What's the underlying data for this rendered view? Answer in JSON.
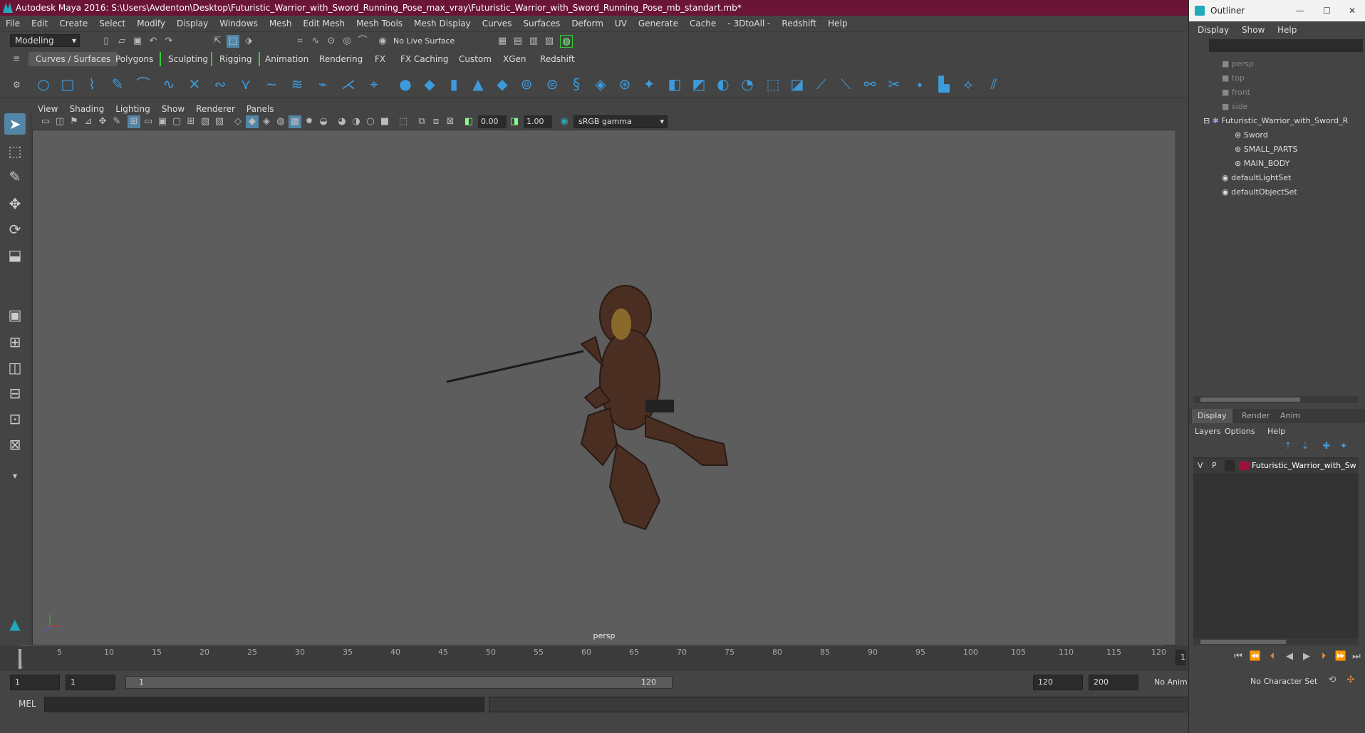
{
  "window": {
    "title": "Autodesk Maya 2016: S:\\Users\\Avdenton\\Desktop\\Futuristic_Warrior_with_Sword_Running_Pose_max_vray\\Futuristic_Warrior_with_Sword_Running_Pose_mb_standart.mb*"
  },
  "menu": [
    "File",
    "Edit",
    "Create",
    "Select",
    "Modify",
    "Display",
    "Windows",
    "Mesh",
    "Edit Mesh",
    "Mesh Tools",
    "Mesh Display",
    "Curves",
    "Surfaces",
    "Deform",
    "UV",
    "Generate",
    "Cache",
    "- 3DtoAll -",
    "Redshift",
    "Help"
  ],
  "status": {
    "mode": "Modeling",
    "live_surface": "No Live Surface"
  },
  "shelf_tabs": [
    "Curves / Surfaces",
    "Polygons",
    "Sculpting",
    "Rigging",
    "Animation",
    "Rendering",
    "FX",
    "FX Caching",
    "Custom",
    "XGen",
    "Redshift"
  ],
  "panel_menu": [
    "View",
    "Shading",
    "Lighting",
    "Show",
    "Renderer",
    "Panels"
  ],
  "panel_toolbar": {
    "exposure": "0.00",
    "gamma": "1.00",
    "colorspace": "sRGB gamma"
  },
  "viewport": {
    "camera": "persp"
  },
  "timeline": {
    "ticks": [
      "1",
      "5",
      "10",
      "15",
      "20",
      "25",
      "30",
      "35",
      "40",
      "45",
      "50",
      "55",
      "60",
      "65",
      "70",
      "75",
      "80",
      "85",
      "90",
      "95",
      "100",
      "105",
      "110",
      "115",
      "120"
    ],
    "current_frame": "1"
  },
  "range": {
    "start": "1",
    "anim_start": "1",
    "slider_start": "1",
    "slider_end": "120",
    "end": "120",
    "anim_end": "200",
    "anim_layer": "No Anim Layer",
    "character_set": "No Character Set"
  },
  "cmdline": {
    "lang": "MEL"
  },
  "outliner": {
    "title": "Outliner",
    "menu": [
      "Display",
      "Show",
      "Help"
    ],
    "items": [
      {
        "label": "persp",
        "dim": true
      },
      {
        "label": "top",
        "dim": true
      },
      {
        "label": "front",
        "dim": true
      },
      {
        "label": "side",
        "dim": true
      },
      {
        "label": "Futuristic_Warrior_with_Sword_R",
        "dim": false
      },
      {
        "label": "Sword",
        "dim": false
      },
      {
        "label": "SMALL_PARTS",
        "dim": false
      },
      {
        "label": "MAIN_BODY",
        "dim": false
      },
      {
        "label": "defaultLightSet",
        "dim": false
      },
      {
        "label": "defaultObjectSet",
        "dim": false
      }
    ]
  },
  "layers": {
    "tabs": [
      "Display",
      "Render",
      "Anim"
    ],
    "menu": [
      "Layers",
      "Options",
      "Help"
    ],
    "row": {
      "v": "V",
      "p": "P",
      "name": "Futuristic_Warrior_with_Sw",
      "color": "#a0103a"
    }
  }
}
